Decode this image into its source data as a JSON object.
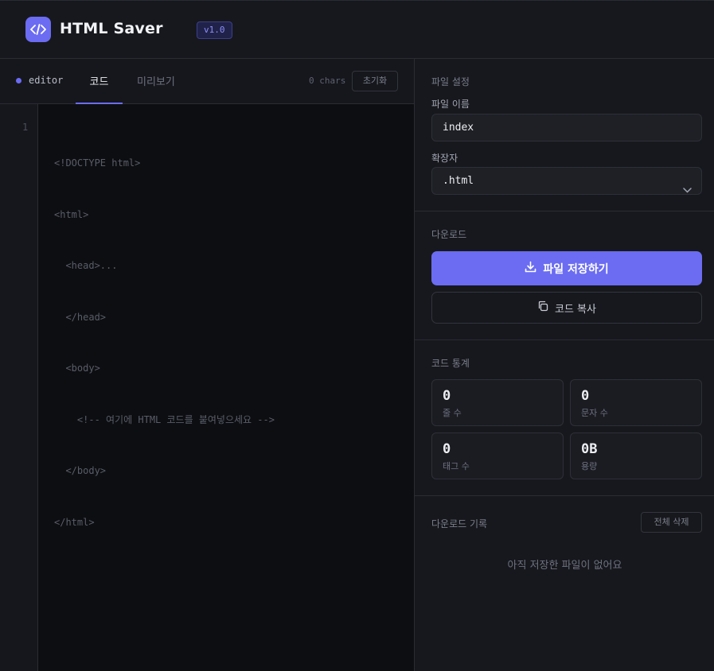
{
  "header": {
    "app_title": "HTML Saver",
    "version": "v1.0"
  },
  "editor": {
    "label": "editor",
    "tabs": [
      {
        "label": "코드",
        "active": true
      },
      {
        "label": "미리보기",
        "active": false
      }
    ],
    "char_count": "0 chars",
    "reset_label": "초기화",
    "line_numbers": [
      "1"
    ],
    "placeholder_lines": [
      "<!DOCTYPE html>",
      "<html>",
      "  <head>...",
      "  </head>",
      "  <body>",
      "    <!-- 여기에 HTML 코드를 붙여넣으세요 -->",
      "  </body>",
      "</html>"
    ]
  },
  "file_settings": {
    "section_title": "파일 설정",
    "name_label": "파일 이름",
    "name_value": "index",
    "ext_label": "확장자",
    "ext_value": ".html"
  },
  "download": {
    "section_title": "다운로드",
    "save_label": "파일 저장하기",
    "copy_label": "코드 복사"
  },
  "stats": {
    "section_title": "코드 통계",
    "items": [
      {
        "value": "0",
        "label": "줄 수"
      },
      {
        "value": "0",
        "label": "문자 수"
      },
      {
        "value": "0",
        "label": "태그 수"
      },
      {
        "value": "0B",
        "label": "용량"
      }
    ]
  },
  "history": {
    "section_title": "다운로드 기록",
    "clear_label": "전체 삭제",
    "empty_message": "아직 저장한 파일이 없어요"
  },
  "colors": {
    "accent": "#6b6cf2",
    "background": "#0f1014",
    "panel": "#17181d"
  },
  "icons": {
    "logo": "code-icon",
    "save": "download-icon",
    "copy": "copy-icon",
    "select": "chevron-down-icon"
  }
}
